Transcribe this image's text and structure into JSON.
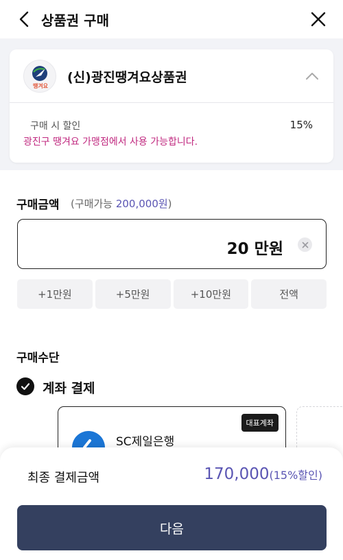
{
  "header": {
    "title": "상품권 구매",
    "back_icon": "chevron-left-icon",
    "close_icon": "close-icon"
  },
  "voucher_card": {
    "title": "(신)광진땡겨요상품권",
    "logo_text": "땡겨요",
    "expanded": true,
    "discount_label": "구매 시 할인",
    "discount_value": "15%",
    "notice": "광진구 땡겨요 가맹점에서 사용 가능합니다."
  },
  "purchase_amount": {
    "label": "구매금액",
    "available_prefix": "(구매가능 ",
    "available_amount": "200,000원",
    "available_suffix": ")",
    "value": "20 만원",
    "quick_buttons": [
      "+1만원",
      "+5만원",
      "+10만원",
      "전액"
    ]
  },
  "payment_method": {
    "label": "구매수단",
    "selected": "계좌 결제",
    "account": {
      "badge": "대표계좌",
      "bank_name": "SC제일은행"
    }
  },
  "summary": {
    "final_label": "최종 결제금액",
    "final_amount": "170,000",
    "discount_note": "(15%할인)",
    "next_label": "다음"
  },
  "colors": {
    "accent_purple": "#5a55b3",
    "notice_magenta": "#c0287f",
    "button_navy": "#34405f",
    "bank_blue": "#1b76d6"
  }
}
